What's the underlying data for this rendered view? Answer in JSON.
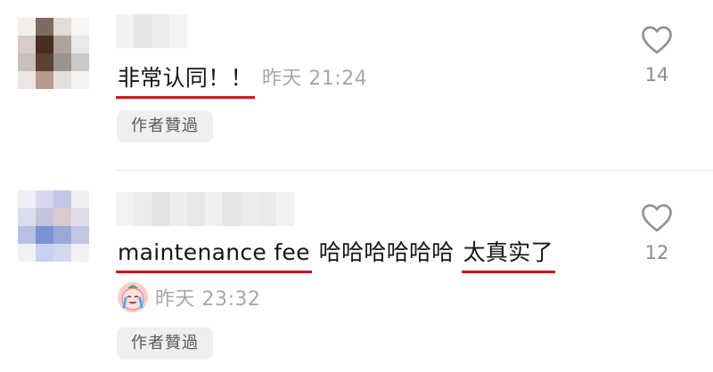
{
  "comments": [
    {
      "text_highlighted": "非常认同！！",
      "timestamp": "昨天 21:24",
      "author_badge": "作者贊過",
      "like_count": "14",
      "avatar_icon": "pixelated-avatar",
      "avatar_pixels": [
        "#f2eeec",
        "#7e6a60",
        "#e3dbd6",
        "#f6f6f6",
        "#d9cbc5",
        "#4a2e22",
        "#b0a39c",
        "#e9e9e9",
        "#cbbdb8",
        "#5c4034",
        "#9a948f",
        "#c9c9c9",
        "#ece5e2",
        "#b69a8c",
        "#e7dfdb",
        "#f3f3f3"
      ],
      "username_pixels": [
        "#f1f1f1",
        "#e6e6e6",
        "#ececec",
        "#f4f4f4"
      ]
    },
    {
      "text_highlighted_1": "maintenance fee",
      "text_plain": "哈哈哈哈哈哈",
      "text_highlighted_2": "太真实了",
      "timestamp": "昨天 23:32",
      "author_badge": "作者贊過",
      "like_count": "12",
      "avatar_icon": "pixelated-avatar",
      "sticker_icon": "crying-laughing-sticker",
      "avatar_pixels": [
        "#eeeef6",
        "#d9d7ee",
        "#c4c6e6",
        "#eeeef4",
        "#d9dced",
        "#c4c3dd",
        "#dcc9d0",
        "#dddde9",
        "#b6c2e4",
        "#7d92d6",
        "#9aa8d7",
        "#c2c8e2",
        "#f0f1f7",
        "#c7d1ee",
        "#d2d9ef",
        "#f1f2f7"
      ],
      "username_pixels": [
        "#f3f3f3",
        "#ebebeb",
        "#e4e4e4",
        "#eeeeee",
        "#e7e7e7",
        "#f0f0f0",
        "#e5e5e5",
        "#ececec",
        "#eaeaea",
        "#f2f2f2"
      ]
    }
  ],
  "colors": {
    "highlight_underline": "#d8101b",
    "timestamp": "#a8a8a8",
    "badge_bg": "#efefef",
    "like_count": "#8a8a8a"
  }
}
